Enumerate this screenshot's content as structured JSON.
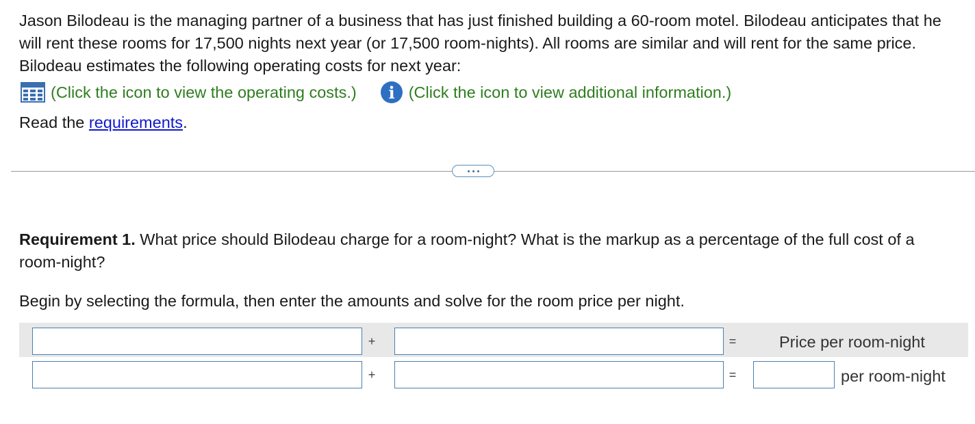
{
  "intro_text": "Jason Bilodeau is the managing partner of a business that has just finished building a 60-room motel. Bilodeau anticipates that he will rent these rooms for 17,500 nights next year (or 17,500 room-nights). All rooms are similar and will rent for the same price. Bilodeau estimates the following operating costs for next year:",
  "links": {
    "operating_costs": "(Click the icon to view the operating costs.)",
    "additional_info": "(Click the icon to view additional information.)",
    "operating_costs_icon": "table-grid-icon",
    "additional_info_icon": "info-icon"
  },
  "read": {
    "prefix": "Read the ",
    "link": "requirements",
    "suffix": "."
  },
  "requirement": {
    "label": "Requirement 1.",
    "question": " What price should Bilodeau charge for a room-night? What is the markup as a percentage of the full cost of a room-night?"
  },
  "instruction": "Begin by selecting the formula, then enter the amounts and solve for the room price per night.",
  "formula": {
    "row1": {
      "op1": "+",
      "op2": "=",
      "result_label": "Price per room-night",
      "input1": "",
      "input2": ""
    },
    "row2": {
      "op1": "+",
      "op2": "=",
      "unit_label": "per room-night",
      "input1": "",
      "input2": "",
      "result": ""
    }
  },
  "colors": {
    "link_green": "#2e7d1f",
    "link_blue": "#0f18cc",
    "input_border": "#4a7fae",
    "row_highlight": "#e8e8e8"
  }
}
